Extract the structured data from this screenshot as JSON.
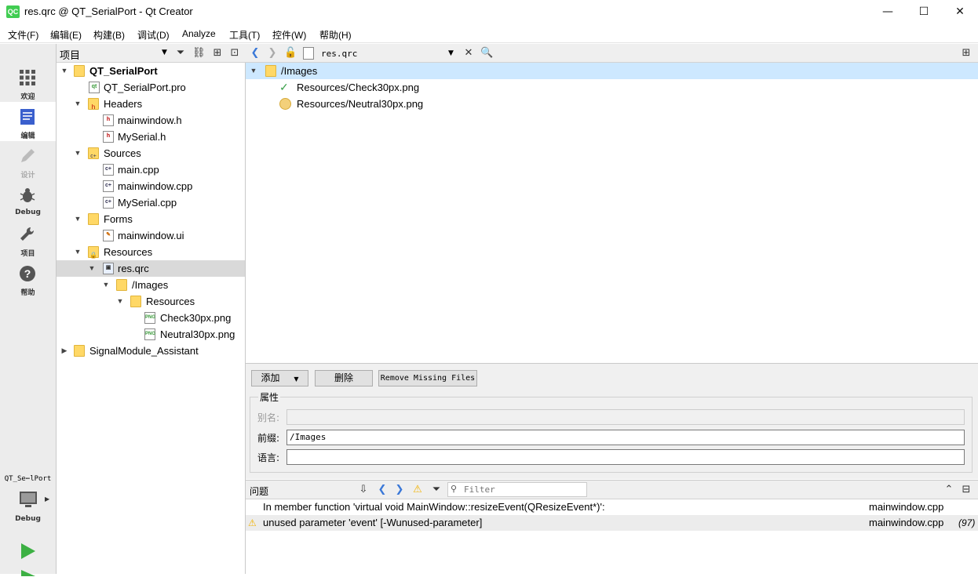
{
  "window": {
    "title": "res.qrc @ QT_SerialPort - Qt Creator",
    "logo_text": "QC",
    "minimize": "—",
    "maximize": "☐",
    "close": "✕"
  },
  "menubar": [
    "文件(F)",
    "编辑(E)",
    "构建(B)",
    "调试(D)",
    "Analyze",
    "工具(T)",
    "控件(W)",
    "帮助(H)"
  ],
  "modes": [
    {
      "label": "欢迎"
    },
    {
      "label": "编辑"
    },
    {
      "label": "设计"
    },
    {
      "label": "Debug"
    },
    {
      "label": "项目"
    },
    {
      "label": "帮助"
    }
  ],
  "target": {
    "project": "QT_Se⋯lPort",
    "config": "Debug"
  },
  "project_panel": {
    "title": "项目",
    "tree": [
      {
        "label": "QT_SerialPort",
        "bold": true
      },
      {
        "label": "QT_SerialPort.pro"
      },
      {
        "label": "Headers"
      },
      {
        "label": "mainwindow.h"
      },
      {
        "label": "MySerial.h"
      },
      {
        "label": "Sources"
      },
      {
        "label": "main.cpp"
      },
      {
        "label": "mainwindow.cpp"
      },
      {
        "label": "MySerial.cpp"
      },
      {
        "label": "Forms"
      },
      {
        "label": "mainwindow.ui"
      },
      {
        "label": "Resources"
      },
      {
        "label": "res.qrc"
      },
      {
        "label": "/Images"
      },
      {
        "label": "Resources"
      },
      {
        "label": "Check30px.png"
      },
      {
        "label": "Neutral30px.png"
      },
      {
        "label": "SignalModule_Assistant"
      }
    ]
  },
  "editor": {
    "open_file": "res.qrc",
    "resource_tree": [
      {
        "label": "/Images"
      },
      {
        "label": "Resources/Check30px.png"
      },
      {
        "label": "Resources/Neutral30px.png"
      }
    ],
    "buttons": {
      "add": "添加",
      "remove": "删除",
      "remove_missing": "Remove Missing Files"
    },
    "properties": {
      "group_title": "属性",
      "alias_label": "别名:",
      "alias_value": "",
      "prefix_label": "前缀:",
      "prefix_value": "/Images",
      "lang_label": "语言:",
      "lang_value": ""
    }
  },
  "issues": {
    "title": "问题",
    "filter_placeholder": "Filter",
    "rows": [
      {
        "text": "In member function 'virtual void MainWindow::resizeEvent(QResizeEvent*)':",
        "file": "mainwindow.cpp",
        "line": ""
      },
      {
        "text": "unused parameter 'event' [-Wunused-parameter]",
        "file": "mainwindow.cpp",
        "line": "(97)"
      }
    ]
  },
  "colors": {
    "accent": "#41cd52",
    "selection": "#cde8ff",
    "warning": "#f2b200"
  }
}
